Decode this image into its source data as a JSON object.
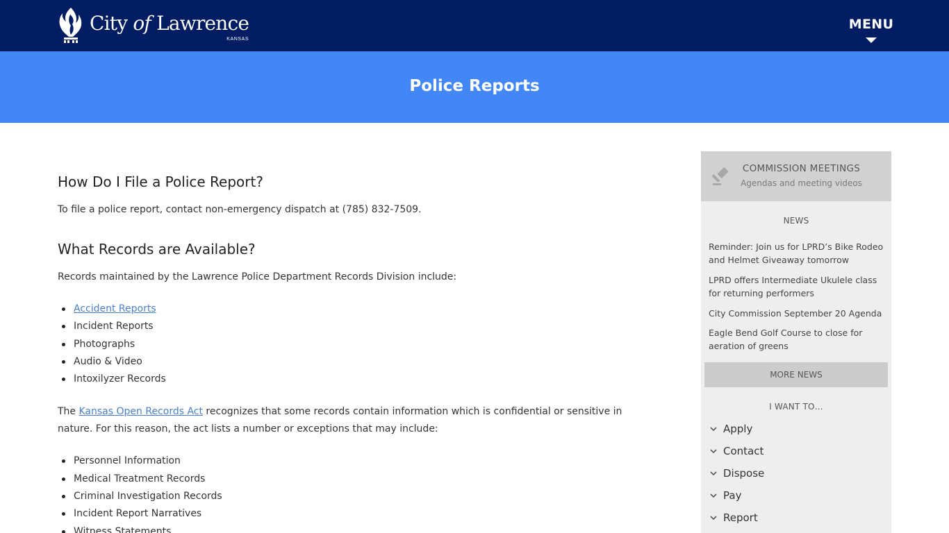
{
  "header": {
    "logo_text_1": "City ",
    "logo_text_of": "of",
    "logo_text_2": " Lawrence",
    "logo_sub": "KANSAS",
    "menu_label": "MENU"
  },
  "page_title": "Police Reports",
  "main": {
    "h1": "How Do I File a Police Report?",
    "p1": "To file a police report, contact non-emergency dispatch at (785) 832-7509.",
    "h2": "What Records are Available?",
    "p2": "Records maintained by the Lawrence Police Department Records Division include:",
    "records": [
      "Accident Reports",
      "Incident Reports",
      "Photographs",
      "Audio & Video",
      "Intoxilyzer Records"
    ],
    "p3_before": "The ",
    "p3_link": "Kansas Open Records Act",
    "p3_after": " recognizes that some records contain information which is confidential or sensitive in nature. For this reason, the act lists a number or exceptions that may include:",
    "exceptions": [
      "Personnel Information",
      "Medical Treatment Records",
      "Criminal Investigation Records",
      "Incident Report Narratives",
      "Witness Statements"
    ]
  },
  "sidebar": {
    "commission_title": "COMMISSION MEETINGS",
    "commission_sub": "Agendas and meeting videos",
    "news_heading": "NEWS",
    "news": [
      "Reminder: Join us for LPRD’s Bike Rodeo and Helmet Giveaway tomorrow",
      "LPRD offers Intermediate Ukulele class for returning performers",
      "City Commission September 20 Agenda",
      "Eagle Bend Golf Course to close for aeration of greens"
    ],
    "more_news": "MORE NEWS",
    "want_heading": "I WANT TO…",
    "want": [
      "Apply",
      "Contact",
      "Dispose",
      "Pay",
      "Report"
    ]
  },
  "colors": {
    "header_bg": "#001c63",
    "title_band_bg": "#4287f5",
    "link": "#4a7fd0",
    "sidebar_bg": "#eeeeee",
    "commission_bg": "#d1d1d1",
    "more_news_bg": "#cccccc"
  },
  "icons": [
    "city-logo-icon",
    "menu-caret-icon",
    "gavel-icon",
    "chevron-down-icon"
  ]
}
